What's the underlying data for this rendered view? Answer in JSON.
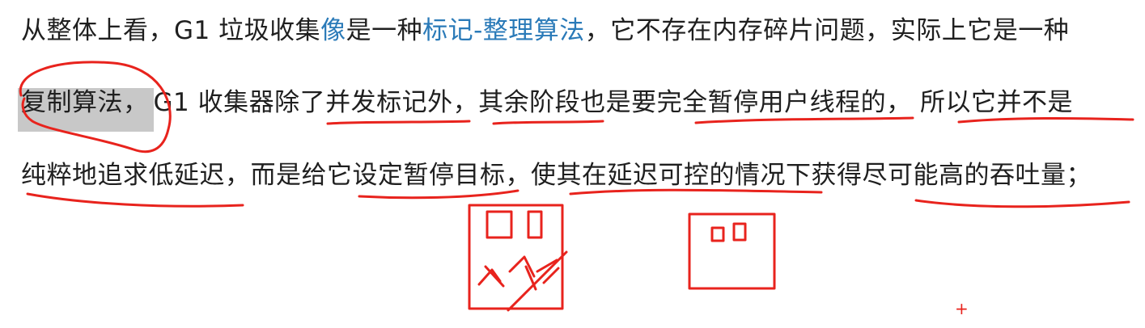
{
  "paragraph": {
    "line1": {
      "t1": "从整体上看，G1 垃圾收集",
      "link1": "像",
      "t2": "是一种",
      "link2": "标记-整理算法",
      "t3": "，它不存在内存碎片问题，实际上它是一种"
    },
    "line2": {
      "highlight": "复制算法，",
      "rest": "G1 收集器除了并发标记外，其余阶段也是要完全暂停用户线程的， 所以它并不是"
    },
    "line3": {
      "text": "纯粹地追求低延迟，而是给它设定暂停目标，使其在延迟可控的情况下获得尽可能高的吞吐量；"
    }
  },
  "annotations": {
    "color": "#e8231d",
    "cursor_glyph": "+"
  }
}
